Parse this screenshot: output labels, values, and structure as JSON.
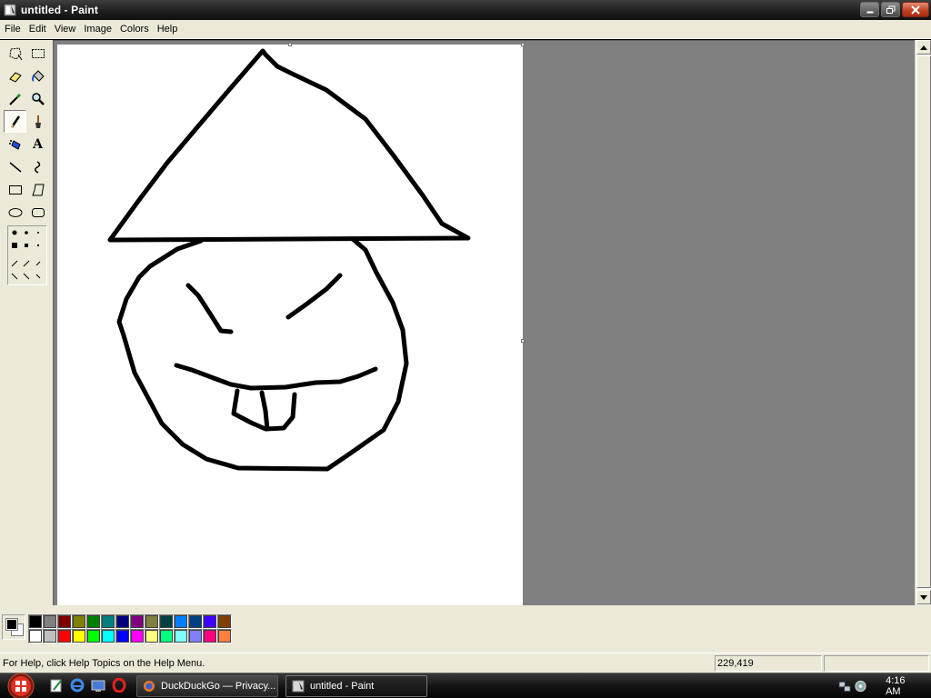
{
  "window": {
    "title": "untitled - Paint"
  },
  "menu": [
    "File",
    "Edit",
    "View",
    "Image",
    "Colors",
    "Help"
  ],
  "tools": [
    "free-select-icon",
    "rect-select-icon",
    "eraser-icon",
    "fill-bucket-icon",
    "color-picker-icon",
    "magnifier-icon",
    "pencil-icon",
    "brush-icon",
    "airbrush-icon",
    "text-icon",
    "line-icon",
    "curve-icon",
    "rectangle-icon",
    "polygon-icon",
    "ellipse-icon",
    "rounded-rect-icon"
  ],
  "tool_text_glyph": "A",
  "active_tool": "pencil-icon",
  "palette": {
    "top": [
      "#000000",
      "#808080",
      "#800000",
      "#808000",
      "#008000",
      "#008080",
      "#000080",
      "#800080",
      "#808040",
      "#004040",
      "#0080ff",
      "#004080",
      "#4000ff",
      "#804000"
    ],
    "bottom": [
      "#ffffff",
      "#c0c0c0",
      "#ff0000",
      "#ffff00",
      "#00ff00",
      "#00ffff",
      "#0000ff",
      "#ff00ff",
      "#ffff80",
      "#00ff80",
      "#80ffff",
      "#8080ff",
      "#ff0080",
      "#ff8040"
    ],
    "foreground": "#000000",
    "background": "#ffffff"
  },
  "status": {
    "help_text": "For Help, click Help Topics on the Help Menu.",
    "coordinates": "229,419",
    "size": ""
  },
  "taskbar": {
    "tasks": [
      {
        "label": "DuckDuckGo — Privacy...",
        "icon": "firefox-icon"
      },
      {
        "label": "untitled - Paint",
        "icon": "paint-icon"
      }
    ],
    "clock": "4:16 AM"
  }
}
